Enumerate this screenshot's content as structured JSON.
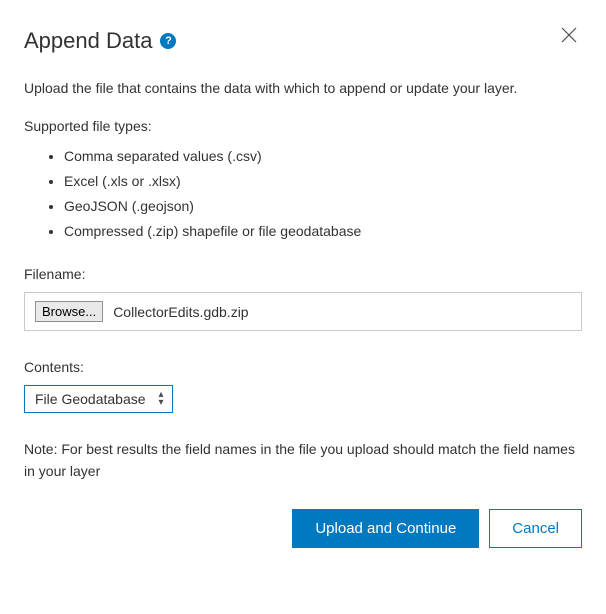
{
  "title": "Append Data",
  "description": "Upload the file that contains the data with which to append or update your layer.",
  "supportedLabel": "Supported file types:",
  "fileTypes": [
    "Comma separated values (.csv)",
    "Excel (.xls or .xlsx)",
    "GeoJSON (.geojson)",
    "Compressed (.zip) shapefile or file geodatabase"
  ],
  "filenameLabel": "Filename:",
  "browseLabel": "Browse...",
  "filenameValue": "CollectorEdits.gdb.zip",
  "contentsLabel": "Contents:",
  "contentsValue": "File Geodatabase",
  "note": "Note: For best results the field names in the file you upload should match the field names in your layer",
  "uploadLabel": "Upload and Continue",
  "cancelLabel": "Cancel",
  "helpGlyph": "?"
}
